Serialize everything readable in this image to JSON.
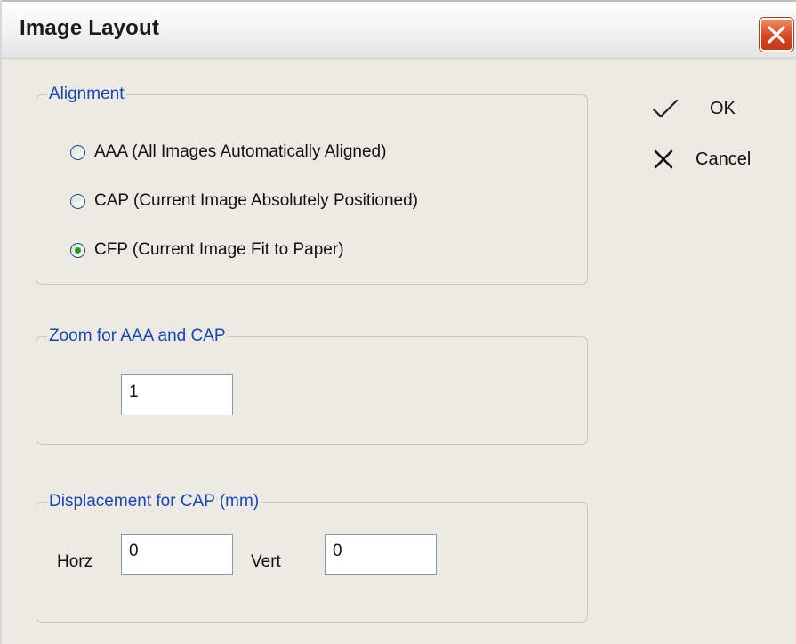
{
  "window": {
    "title": "Image Layout",
    "close_icon": "close-icon"
  },
  "actions": {
    "ok_label": "OK",
    "cancel_label": "Cancel"
  },
  "alignment": {
    "legend": "Alignment",
    "options": [
      {
        "label": "AAA (All Images Automatically Aligned)",
        "selected": false
      },
      {
        "label": "CAP (Current Image Absolutely Positioned)",
        "selected": false
      },
      {
        "label": "CFP (Current Image Fit to Paper)",
        "selected": true
      }
    ]
  },
  "zoom": {
    "legend": "Zoom for AAA and CAP",
    "value": "1"
  },
  "displacement": {
    "legend": "Displacement for CAP (mm)",
    "horz_label": "Horz",
    "horz_value": "0",
    "vert_label": "Vert",
    "vert_value": "0"
  },
  "colors": {
    "legend_text": "#1846b8",
    "radio_selected": "#21a121",
    "close_button": "#d7451f"
  }
}
